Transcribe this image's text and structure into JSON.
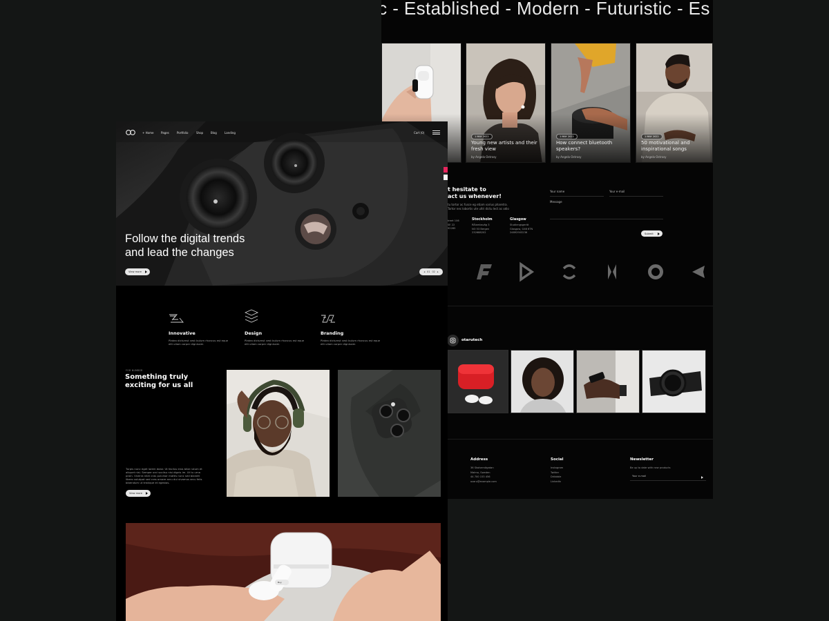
{
  "back_page": {
    "marquee_text": "ic - Established - Modern - Futuristic - Es",
    "blog_posts": [
      {
        "date": "",
        "title": "",
        "author": ""
      },
      {
        "date": "1 MAY 2022",
        "title": "Young new artists and their fresh view",
        "author": "by Angela Ostrosy"
      },
      {
        "date": "1 MAY 2022",
        "title": "How connect bluetooth speakers?",
        "author": "by Angela Ostrosy"
      },
      {
        "date": "1 MAY 2022",
        "title": "50 motivational and inspirational songs",
        "author": "by Angela Ostrosy"
      }
    ],
    "contact": {
      "heading_line1": "t hesitate to",
      "heading_line2": "act us whenever!",
      "intro": "tu tortor ac fusce eg etiam varius pharetra. Tortor nec lobortis ute ultri dictu lect ac odio",
      "offices": [
        {
          "city": "",
          "address": "treet 106",
          "city_line": "SE 22",
          "phone": "92285"
        },
        {
          "city": "Stockholm",
          "address": "Rålambsväg 3",
          "city_line": "NO 53 Bergen",
          "phone": "232688202"
        },
        {
          "city": "Glasgow",
          "address": "Studiengsgerät",
          "city_line": "Glasgow, G46 6TN",
          "phone": "24892903236"
        }
      ],
      "name_placeholder": "Your name",
      "email_placeholder": "Your e-mail",
      "message_placeholder": "Message",
      "submit_label": "Submit"
    },
    "instagram": {
      "handle": "otarutech"
    },
    "footer": {
      "address": {
        "heading": "Address",
        "lines": [
          "36 Skolvervägatan",
          "Malmo, Sweden",
          "44 700 153 456",
          "ozaru@example.com"
        ]
      },
      "social": {
        "heading": "Social",
        "links": [
          "Instagram",
          "Twitter",
          "Dribbble",
          "LinkedIn"
        ]
      },
      "newsletter": {
        "heading": "Newsletter",
        "subtitle": "Be up to date with new products",
        "placeholder": "Your e-mail"
      }
    }
  },
  "front_page": {
    "nav": {
      "items": [
        "+ Home",
        "Pages",
        "Portfolio",
        "Shop",
        "Blog",
        "Landing"
      ],
      "cart_label": "Cart (0)"
    },
    "hero": {
      "title_line1": "Follow the digital trends",
      "title_line2": "and lead the changes",
      "button_label": "View more",
      "slide_current": "01",
      "slide_total": "02"
    },
    "features": [
      {
        "title": "Innovative",
        "text": "Platea dictumst vest bulum rhoncus est eque elit ullam corper dignissim"
      },
      {
        "title": "Design",
        "text": "Platea dictumst vest bulum rhoncus est eque elit ullam corper dignissim"
      },
      {
        "title": "Branding",
        "text": "Platea dictumst vest bulum rhoncus est eque elit ullam corper dignissim"
      }
    ],
    "section2": {
      "kicker": "FOR NUMBER",
      "title_line1": "Something truly",
      "title_line2": "exciting for us all",
      "text": "Turpis nunc eget lorem dolor. Ut facilus eros bibe rutum et aliquet nisi. Semper orci sociisu nisi dignis im. Ut tu urna proin. Viverra nibh cras pulvinar mattis nunc sed blandit libero volutpat sed cras ornare arcu dui vivamus arcu felis bibendum ut tristique et egestas.",
      "button_label": "View more"
    },
    "product_label": "Buy"
  },
  "colors": {
    "accent_pink": "#e8265e",
    "background": "#141615",
    "page_bg": "#050505"
  }
}
